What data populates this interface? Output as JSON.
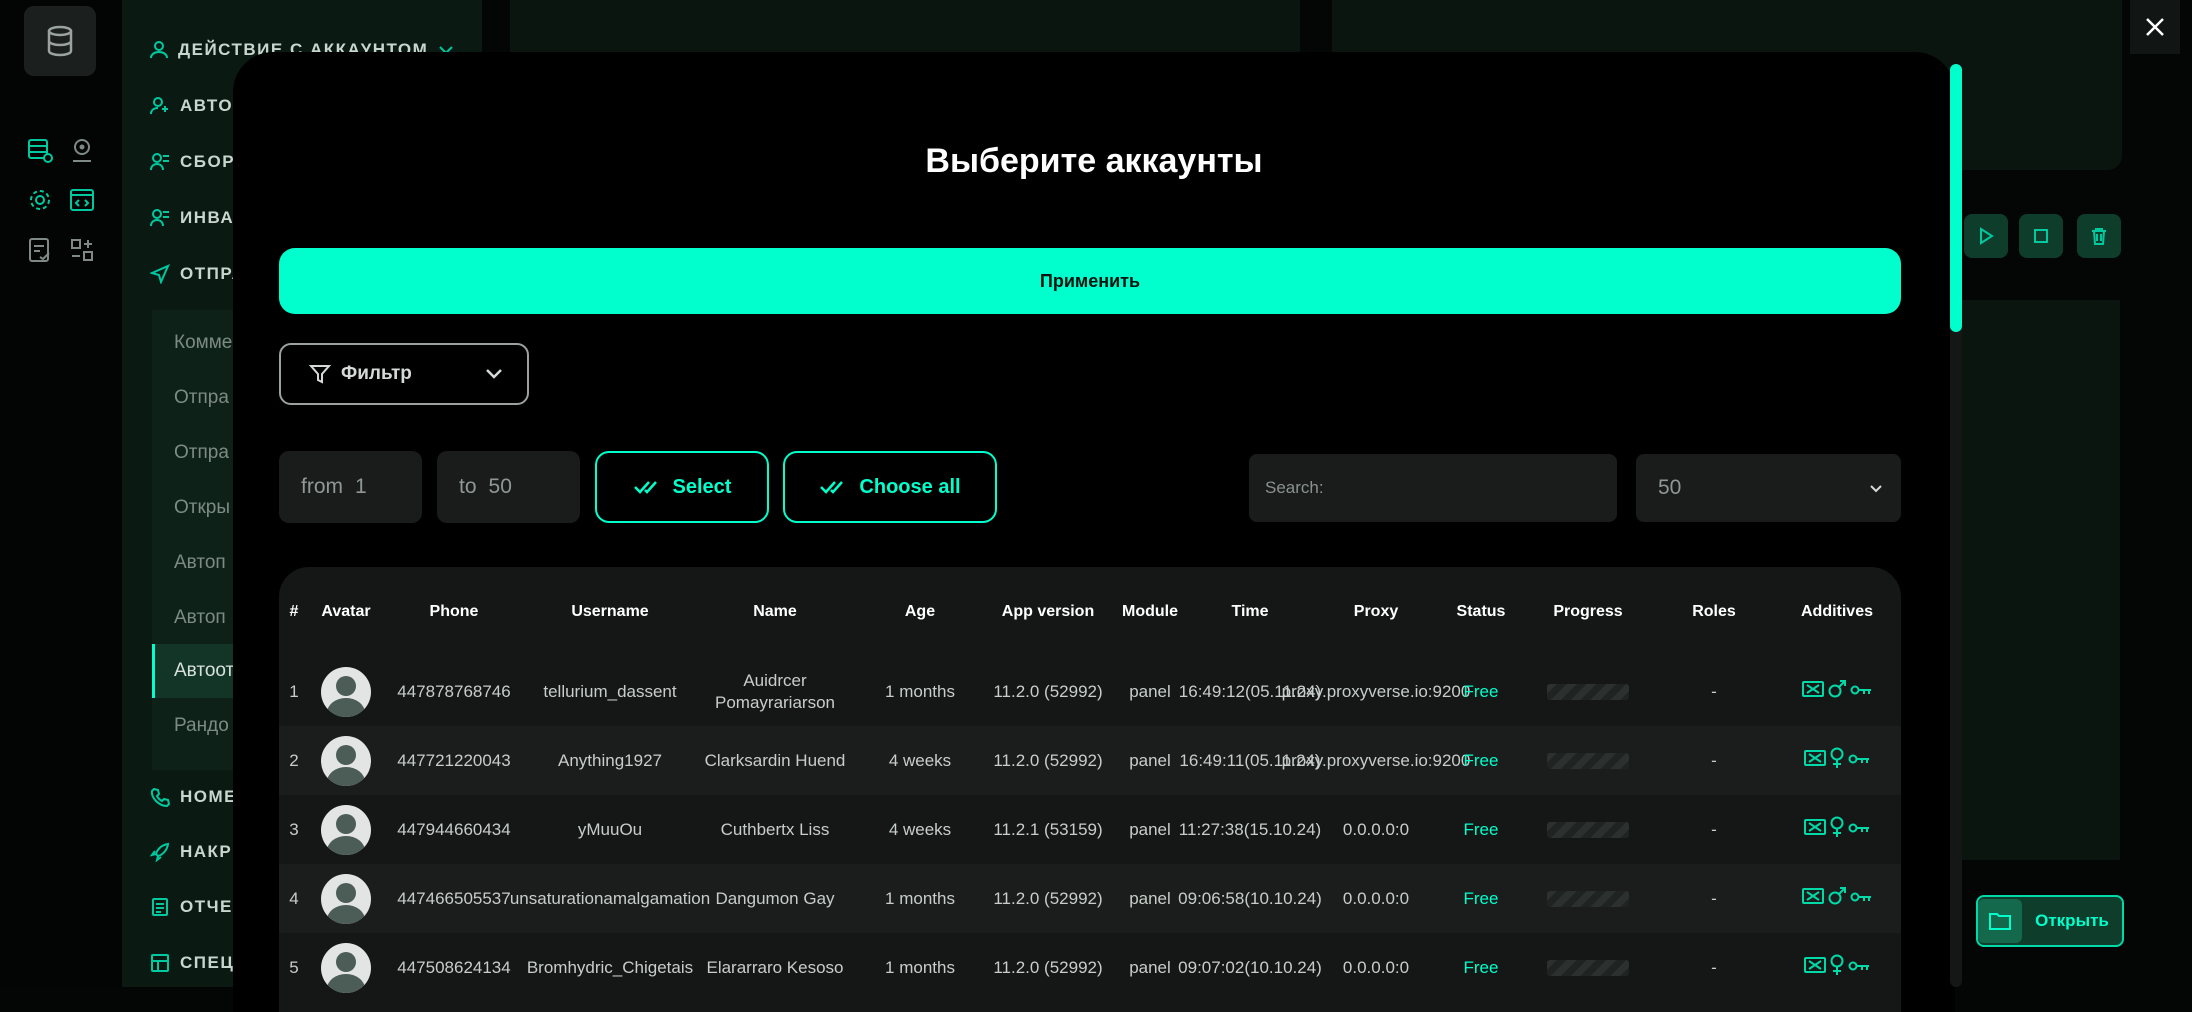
{
  "background": {
    "sidebar": {
      "items": [
        {
          "label": "ДЕЙСТВИЕ С АККАУНТОМ",
          "icon": "user-icon"
        },
        {
          "label": "АВТО",
          "icon": "user-plus-icon"
        },
        {
          "label": "СБОР",
          "icon": "users-icon"
        },
        {
          "label": "ИНВА",
          "icon": "users-icon"
        },
        {
          "label": "ОТПРА",
          "icon": "send-icon"
        },
        {
          "label": "НОМЕ",
          "icon": "phone-icon"
        },
        {
          "label": "НАКР",
          "icon": "rocket-icon"
        },
        {
          "label": "ОТЧЕ",
          "icon": "report-icon"
        },
        {
          "label": "СПЕЦ",
          "icon": "grid-icon"
        }
      ],
      "subitems": [
        "Комме",
        "Отпра",
        "Отпра",
        "Откры",
        "Автоп",
        "Автоп",
        "Автоот",
        "Рандо"
      ]
    },
    "open_button_label": "Открыть"
  },
  "modal": {
    "title": "Выберите аккаунты",
    "apply_label": "Применить",
    "filter_label": "Фильтр",
    "range": {
      "from_label": "from",
      "from_value": "1",
      "to_label": "to",
      "to_value": "50"
    },
    "select_label": "Select",
    "choose_all_label": "Choose all",
    "search_placeholder": "Search:",
    "per_page": "50",
    "accent_color": "#00ffcc"
  },
  "table": {
    "columns": [
      "#",
      "Avatar",
      "Phone",
      "Username",
      "Name",
      "Age",
      "App version",
      "Module",
      "Time",
      "Proxy",
      "Status",
      "Progress",
      "Roles",
      "Additives"
    ],
    "rows": [
      {
        "n": "1",
        "phone": "447878768746",
        "username": "tellurium_dassent",
        "name": "Auidrcer Pomayrariarson",
        "age": "1 months",
        "app": "11.2.0 (52992)",
        "module": "panel",
        "time": "16:49:12(05.11.24)",
        "proxy": "proxy.proxyverse.io:9200",
        "status": "Free",
        "roles": "-",
        "gender": "male"
      },
      {
        "n": "2",
        "phone": "447721220043",
        "username": "Anything1927",
        "name": "Clarksardin Huend",
        "age": "4 weeks",
        "app": "11.2.0 (52992)",
        "module": "panel",
        "time": "16:49:11(05.11.24)",
        "proxy": "proxy.proxyverse.io:9200",
        "status": "Free",
        "roles": "-",
        "gender": "female"
      },
      {
        "n": "3",
        "phone": "447944660434",
        "username": "yMuuOu",
        "name": "Cuthbertx Liss",
        "age": "4 weeks",
        "app": "11.2.1 (53159)",
        "module": "panel",
        "time": "11:27:38(15.10.24)",
        "proxy": "0.0.0.0:0",
        "status": "Free",
        "roles": "-",
        "gender": "female"
      },
      {
        "n": "4",
        "phone": "447466505537",
        "username": "unsaturationamalgamation",
        "name": "Dangumon Gay",
        "age": "1 months",
        "app": "11.2.0 (52992)",
        "module": "panel",
        "time": "09:06:58(10.10.24)",
        "proxy": "0.0.0.0:0",
        "status": "Free",
        "roles": "-",
        "gender": "male"
      },
      {
        "n": "5",
        "phone": "447508624134",
        "username": "Bromhydric_Chigetais",
        "name": "Elararraro Kesoso",
        "age": "1 months",
        "app": "11.2.0 (52992)",
        "module": "panel",
        "time": "09:07:02(10.10.24)",
        "proxy": "0.0.0.0:0",
        "status": "Free",
        "roles": "-",
        "gender": "female"
      }
    ]
  }
}
